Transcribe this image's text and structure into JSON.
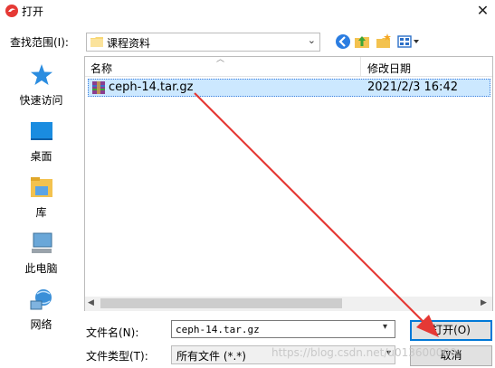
{
  "window": {
    "title": "打开",
    "close_glyph": "✕"
  },
  "look_in": {
    "label": "查找范围(I):",
    "value": "课程资料",
    "arrow": "⌄"
  },
  "toolbar": {
    "back_icon": "back-icon",
    "up_icon": "up-folder-icon",
    "new_folder_icon": "new-folder-icon",
    "views_icon": "views-menu-icon"
  },
  "places": [
    {
      "label": "快速访问",
      "icon": "star-icon"
    },
    {
      "label": "桌面",
      "icon": "desktop-icon"
    },
    {
      "label": "库",
      "icon": "library-icon"
    },
    {
      "label": "此电脑",
      "icon": "computer-icon"
    },
    {
      "label": "网络",
      "icon": "network-icon"
    }
  ],
  "file_list": {
    "columns": [
      "名称",
      "修改日期"
    ],
    "files": [
      {
        "name": "ceph-14.tar.gz",
        "modified": "2021/2/3 16:42",
        "icon": "archive-icon",
        "selected": true
      }
    ]
  },
  "filename": {
    "label": "文件名(N):",
    "value": "ceph-14.tar.gz"
  },
  "filetype": {
    "label": "文件类型(T):",
    "value": "所有文件 (*.*)"
  },
  "buttons": {
    "open": "打开(O)",
    "cancel": "取消"
  },
  "watermark": "https://blog.csdn.net/u013600000",
  "colors": {
    "selection": "#cce8ff",
    "accent": "#0078d7",
    "annotation": "#e53935"
  }
}
